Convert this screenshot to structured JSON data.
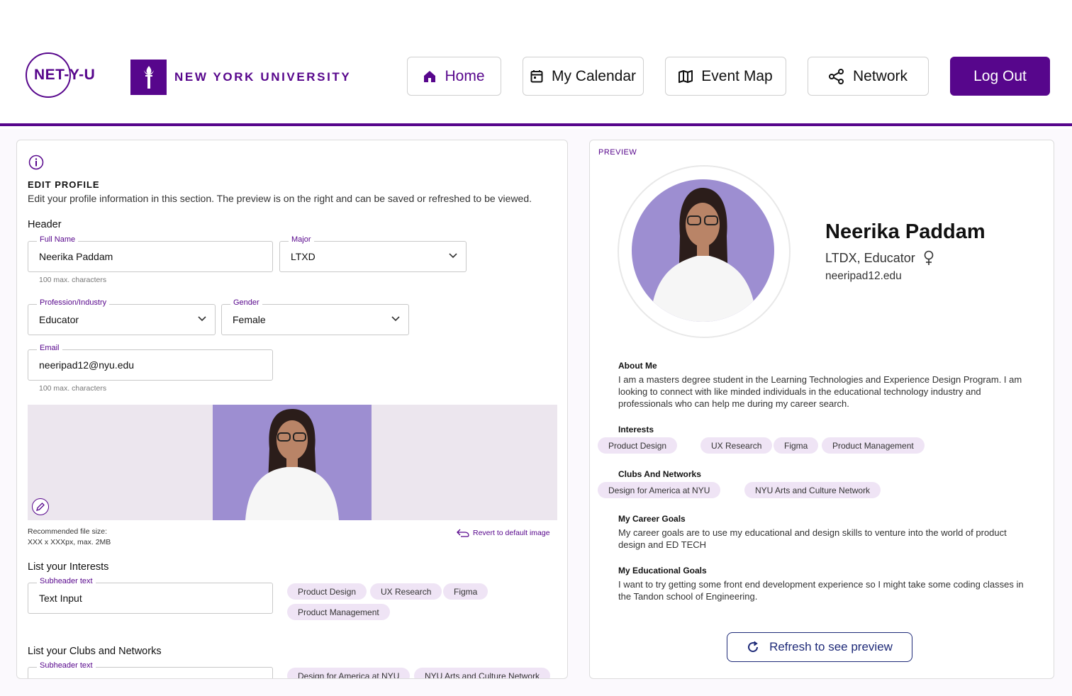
{
  "brand": {
    "app_logo": "NET-Y-U",
    "university": "NEW YORK UNIVERSITY"
  },
  "nav": {
    "home": "Home",
    "calendar": "My Calendar",
    "event_map": "Event Map",
    "network": "Network",
    "logout": "Log Out"
  },
  "edit": {
    "title": "EDIT PROFILE",
    "description": "Edit your profile information in this section. The preview is on the right and can be saved or refreshed to be viewed.",
    "header_label": "Header",
    "full_name": {
      "label": "Full Name",
      "value": "Neerika Paddam",
      "helper": "100 max. characters"
    },
    "major": {
      "label": "Major",
      "value": "LTXD"
    },
    "profession": {
      "label": "Profession/Industry",
      "value": "Educator"
    },
    "gender": {
      "label": "Gender",
      "value": "Female"
    },
    "email": {
      "label": "Email",
      "value": "neeripad12@nyu.edu",
      "helper": "100 max. characters"
    },
    "file_note_1": "Recommended file size:",
    "file_note_2": "XXX x XXXpx, max. 2MB",
    "revert": "Revert to default image",
    "interests_label": "List your Interests",
    "interests_input": {
      "label": "Subheader text",
      "value": "Text Input"
    },
    "interests": [
      "Product Design",
      "UX Research",
      "Figma",
      "Product Management"
    ],
    "clubs_label": "List your Clubs and Networks",
    "clubs_input": {
      "label": "Subheader text",
      "value": ""
    },
    "clubs": [
      "Design for America at NYU",
      "NYU Arts and Culture Network"
    ]
  },
  "preview": {
    "label": "PREVIEW",
    "name": "Neerika Paddam",
    "role": "LTDX, Educator",
    "email": "neeripad12.edu",
    "about_head": "About Me",
    "about_text": "I am a masters degree student in the Learning Technologies and Experience Design Program. I am looking to connect with like minded individuals in the educational technology industry and professionals who can help me during my career search.",
    "interests_head": "Interests",
    "interests": [
      "Product Design",
      "UX Research",
      "Figma",
      "Product Management"
    ],
    "clubs_head": "Clubs And Networks",
    "clubs": [
      "Design for America at NYU",
      "NYU Arts and Culture Network"
    ],
    "career_head": "My Career Goals",
    "career_text": "My career goals are to use my educational and design skills to venture into the world of product design and ED TECH",
    "edu_head": "My Educational Goals",
    "edu_text": "I want to try getting some front end development experience so I might take some coding classes in the Tandon school of Engineering.",
    "refresh": "Refresh to see preview"
  },
  "colors": {
    "brand": "#57068c",
    "chip": "#efe4f5",
    "refresh": "#1e2a78"
  },
  "icons": [
    "home-icon",
    "calendar-icon",
    "map-icon",
    "share-icon",
    "info-icon",
    "chevron-down-icon",
    "pencil-icon",
    "undo-icon",
    "female-icon",
    "refresh-icon"
  ]
}
